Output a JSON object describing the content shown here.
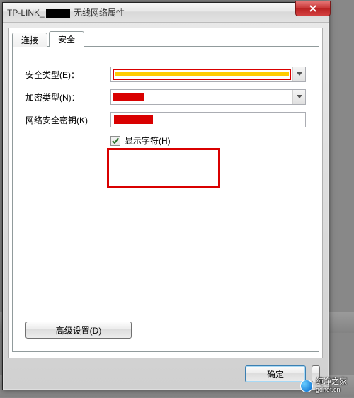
{
  "titlebar": {
    "prefix": "TP-LINK_",
    "suffix": " 无线网络属性"
  },
  "tabs": {
    "connection": "连接",
    "security": "安全"
  },
  "form": {
    "security_type_label": "安全类型(E)：",
    "encryption_type_label": "加密类型(N)：",
    "network_key_label": "网络安全密钥(K)",
    "show_chars_label": "显示字符(H)"
  },
  "buttons": {
    "advanced": "高级设置(D)",
    "ok": "确定"
  },
  "watermark": {
    "name": "纯净之家",
    "url": "gdnet.cn"
  }
}
